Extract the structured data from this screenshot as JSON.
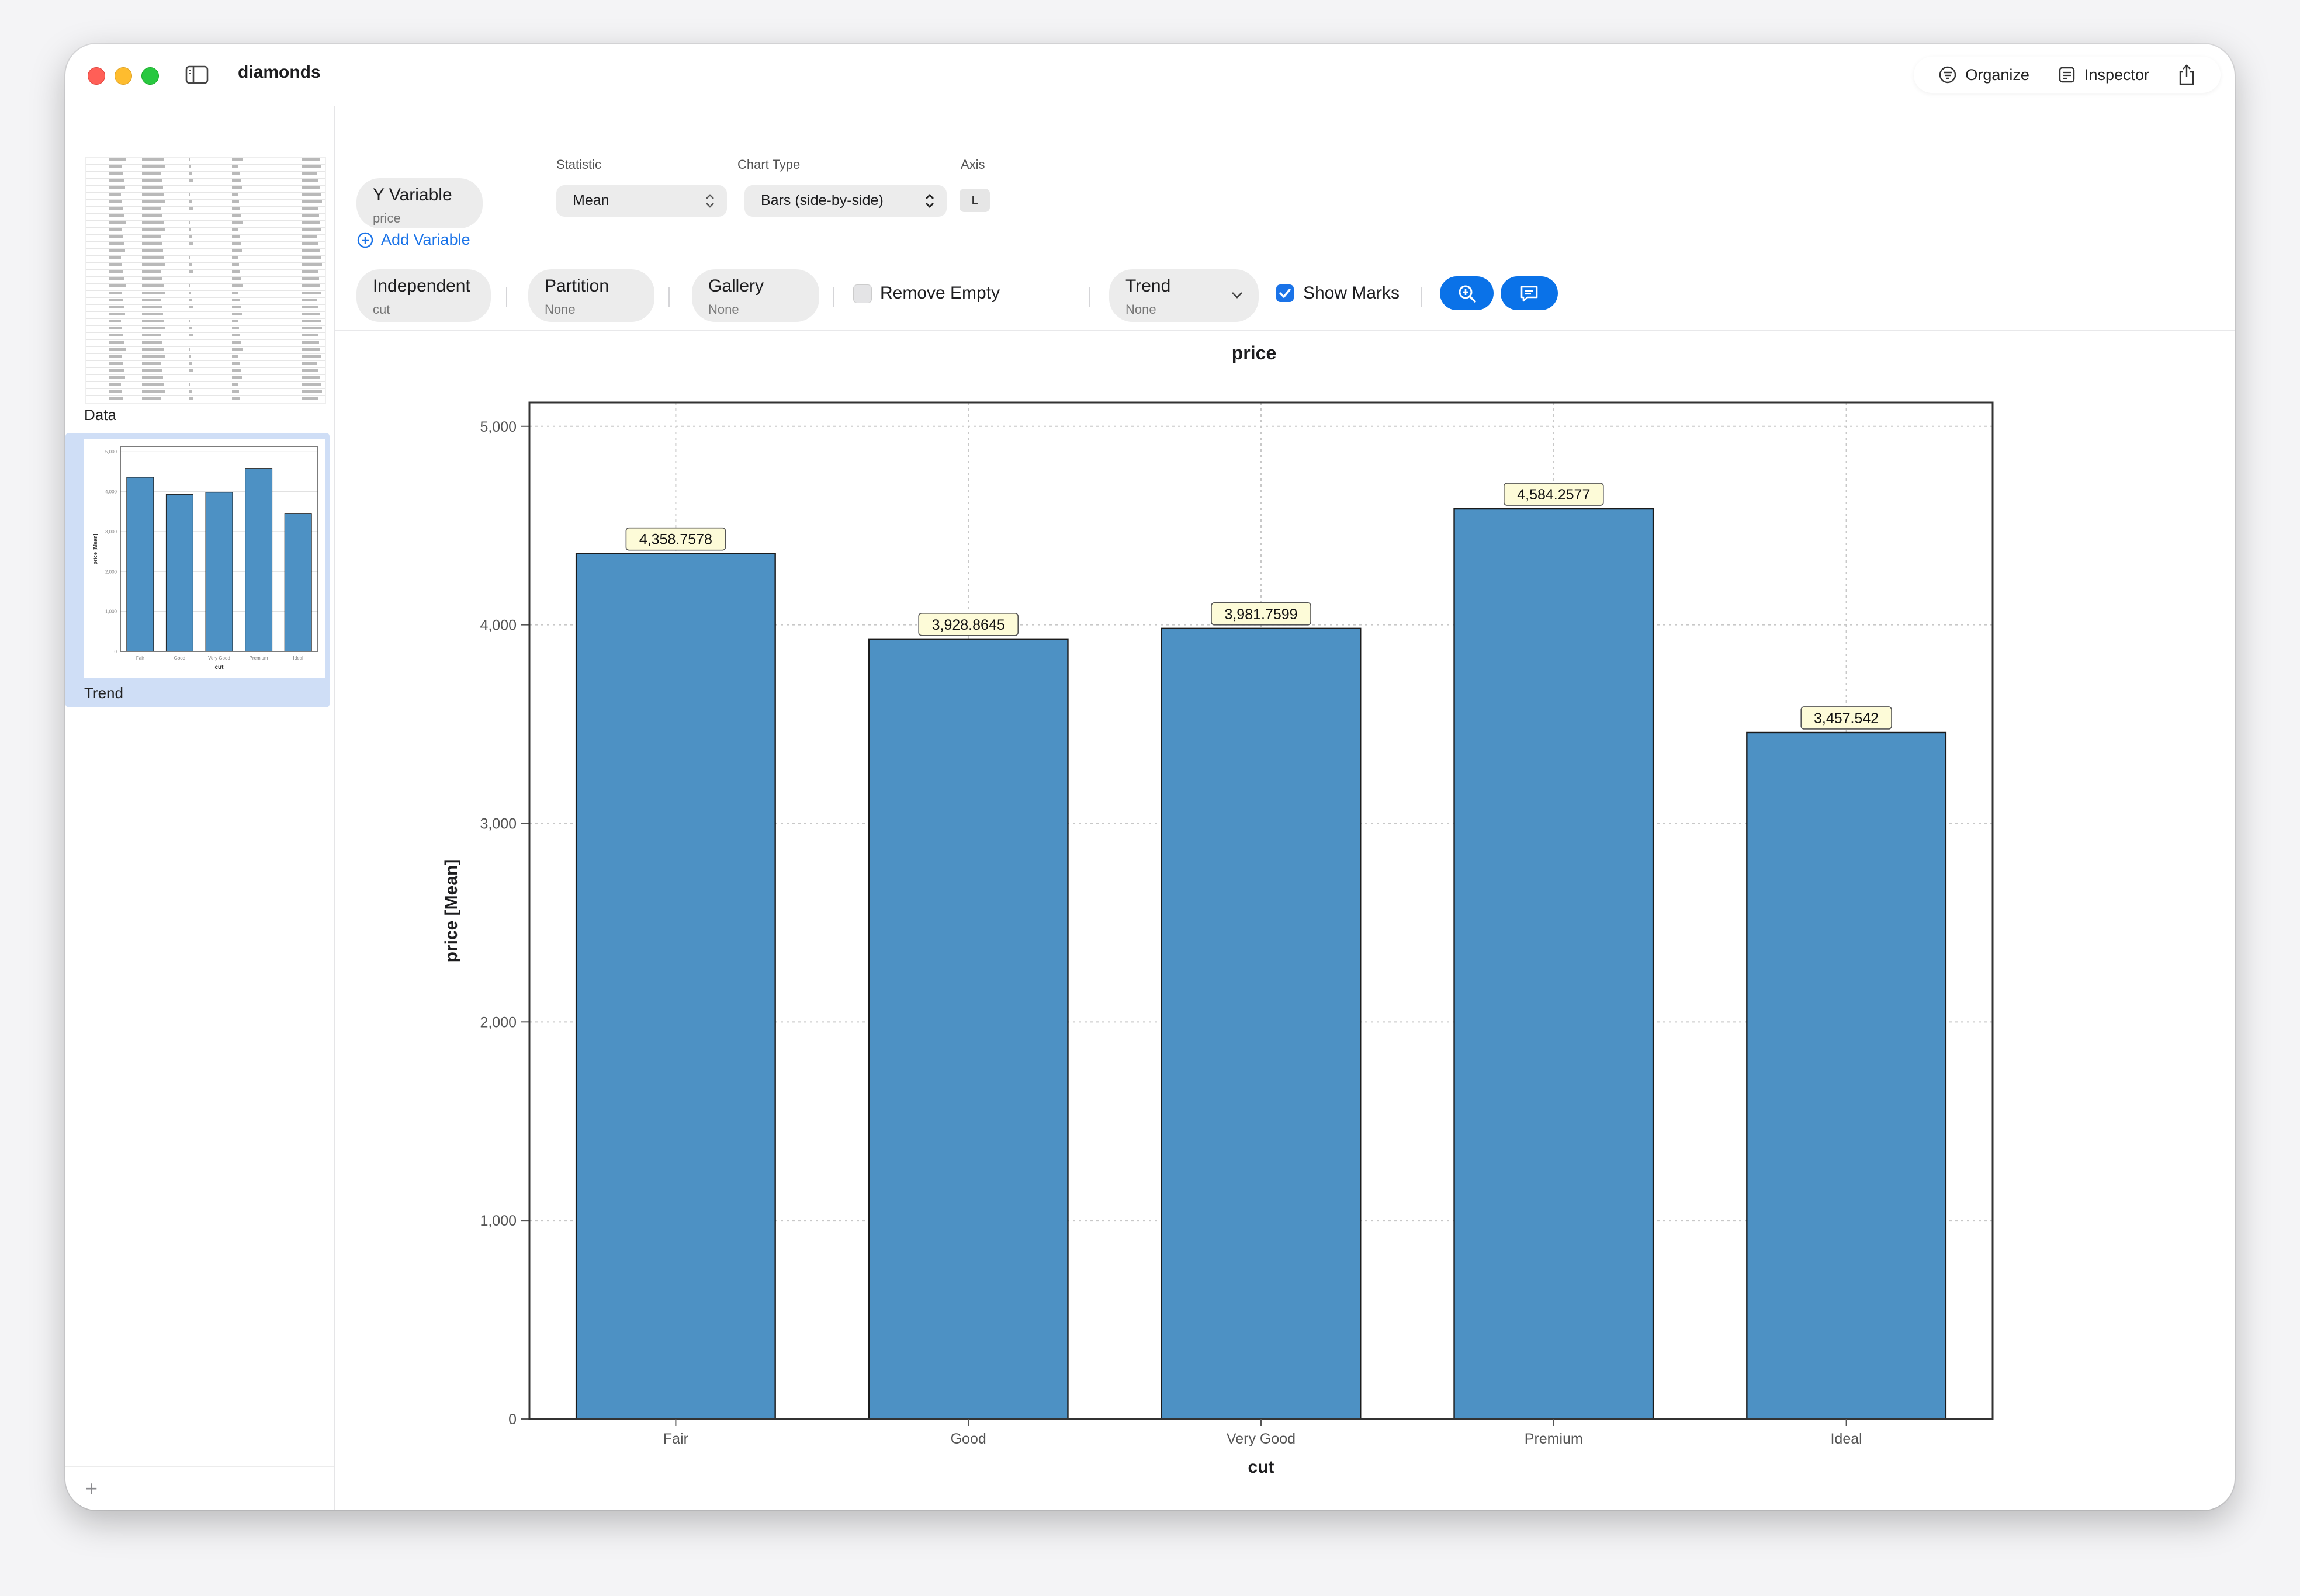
{
  "window": {
    "title": "diamonds"
  },
  "toolbar": {
    "organize_label": "Organize",
    "inspector_label": "Inspector"
  },
  "sidebar": {
    "items": [
      {
        "label": "Data"
      },
      {
        "label": "Trend"
      }
    ]
  },
  "controls": {
    "y_variable": {
      "title": "Y Variable",
      "value": "price"
    },
    "statistic": {
      "label": "Statistic",
      "value": "Mean"
    },
    "chart_type": {
      "label": "Chart Type",
      "value": "Bars (side-by-side)"
    },
    "axis": {
      "label": "Axis",
      "value": "L"
    },
    "add_variable_label": "Add Variable",
    "independent": {
      "title": "Independent",
      "value": "cut"
    },
    "partition": {
      "title": "Partition",
      "value": "None"
    },
    "gallery": {
      "title": "Gallery",
      "value": "None"
    },
    "remove_empty_label": "Remove Empty",
    "trend": {
      "title": "Trend",
      "value": "None"
    },
    "show_marks_label": "Show Marks"
  },
  "colors": {
    "bar": "#4d91c4",
    "accent": "#0a72e8",
    "label_bg": "#fdfbd8"
  },
  "chart_data": {
    "type": "bar",
    "title": "price",
    "xlabel": "cut",
    "ylabel": "price [Mean]",
    "categories": [
      "Fair",
      "Good",
      "Very Good",
      "Premium",
      "Ideal"
    ],
    "values": [
      4358.7578,
      3928.8645,
      3981.7599,
      4584.2577,
      3457.542
    ],
    "value_labels": [
      "4,358.7578",
      "3,928.8645",
      "3,981.7599",
      "4,584.2577",
      "3,457.542"
    ],
    "yticks": [
      0,
      1000,
      2000,
      3000,
      4000,
      5000
    ],
    "ytick_labels": [
      "0",
      "1,000",
      "2,000",
      "3,000",
      "4,000",
      "5,000"
    ],
    "ylim": [
      0,
      5120
    ],
    "grid": true
  }
}
